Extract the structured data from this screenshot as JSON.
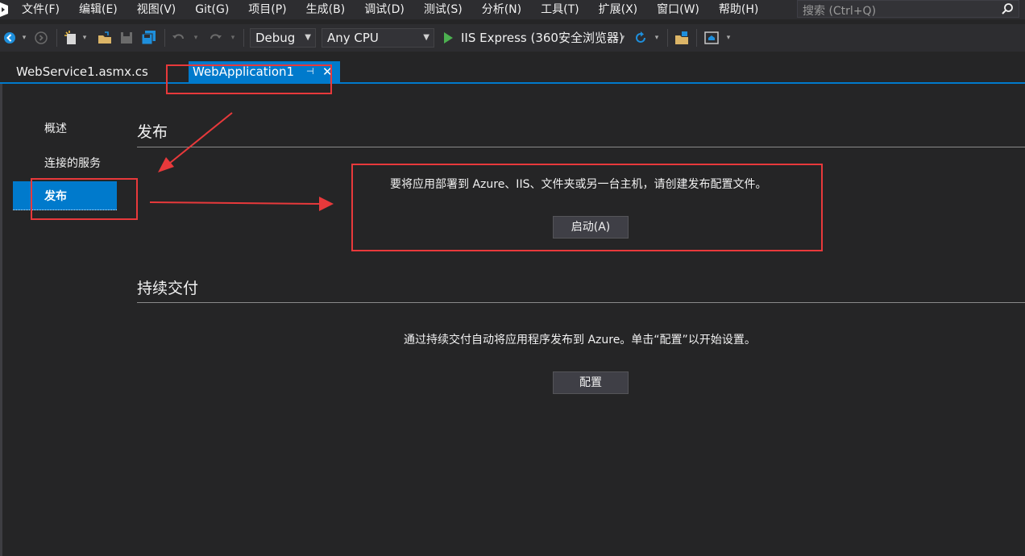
{
  "menu": [
    "文件(F)",
    "编辑(E)",
    "视图(V)",
    "Git(G)",
    "项目(P)",
    "生成(B)",
    "调试(D)",
    "测试(S)",
    "分析(N)",
    "工具(T)",
    "扩展(X)",
    "窗口(W)",
    "帮助(H)"
  ],
  "search": {
    "placeholder": "搜索 (Ctrl+Q)",
    "icon": "search-icon"
  },
  "toolbar": {
    "config": "Debug",
    "platform": "Any CPU",
    "run_target": "IIS Express (360安全浏览器)"
  },
  "tabs": [
    {
      "label": "WebService1.asmx.cs",
      "active": false
    },
    {
      "label": "WebApplication1",
      "active": true
    }
  ],
  "nav": {
    "items": [
      "概述",
      "连接的服务",
      "发布"
    ],
    "selected": "发布"
  },
  "publish": {
    "title": "发布",
    "description": "要将应用部署到 Azure、IIS、文件夹或另一台主机，请创建发布配置文件。",
    "button": "启动(A)"
  },
  "cd": {
    "title": "持续交付",
    "description": "通过持续交付自动将应用程序发布到 Azure。单击“配置”以开始设置。",
    "button": "配置"
  },
  "colors": {
    "accent": "#007acc",
    "background": "#252526",
    "chrome": "#2d2d30",
    "annotation": "#e8393b"
  }
}
